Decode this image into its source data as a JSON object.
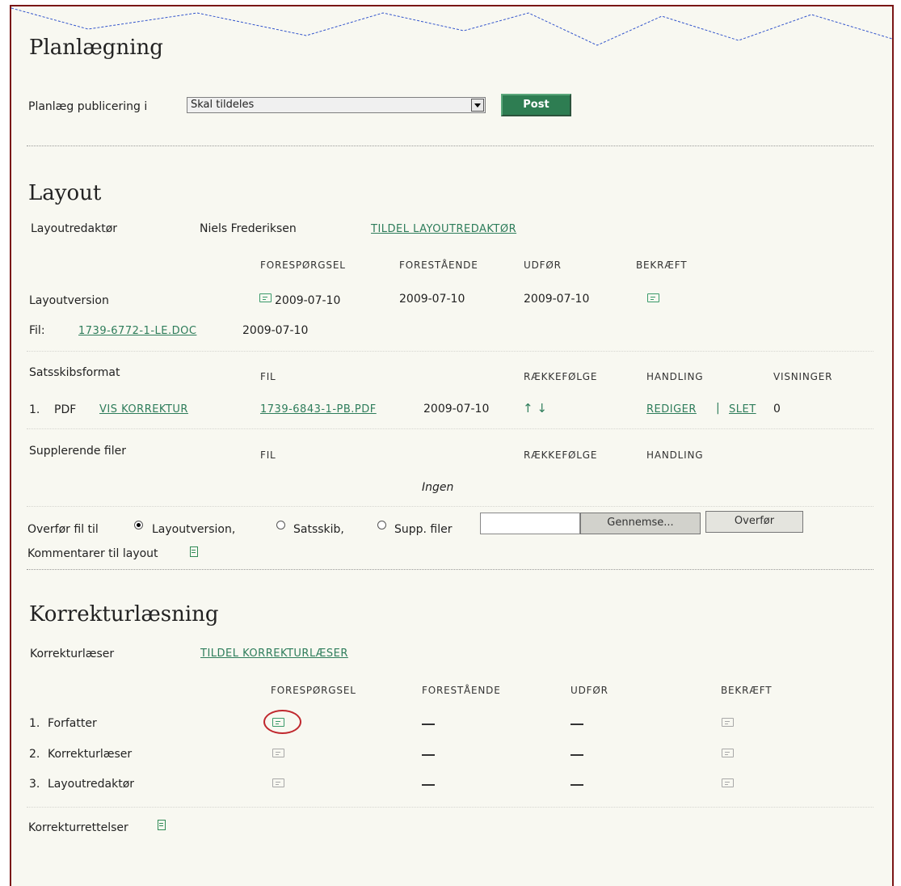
{
  "scheduling": {
    "title": "Planlægning",
    "label": "Planlæg publicering i",
    "select_value": "Skal tildeles",
    "post_button": "Post"
  },
  "layout": {
    "title": "Layout",
    "editor_label": "Layoutredaktør",
    "editor_name": "Niels Frederiksen",
    "assign_link": "TILDEL LAYOUTREDAKTØR",
    "columns": [
      "FORESPØRGSEL",
      "FORESTÅENDE",
      "UDFØR",
      "BEKRÆFT"
    ],
    "version_label": "Layoutversion",
    "request_date": "2009-07-10",
    "underway_date": "2009-07-10",
    "complete_date": "2009-07-10",
    "file_label": "Fil:",
    "file_link": "1739-6772-1-LE.DOC",
    "file_date": "2009-07-10",
    "galley": {
      "label": "Satsskibsformat",
      "columns": [
        "FIL",
        "RÆKKEFØLGE",
        "HANDLING",
        "VISNINGER"
      ],
      "row_number": "1.",
      "row_format": "PDF",
      "proof_link": "VIS KORREKTUR",
      "file_link": "1739-6843-1-PB.PDF",
      "file_date": "2009-07-10",
      "order_arrows": "↑ ↓",
      "edit_link": "REDIGER",
      "action_separator": "|",
      "delete_link": "SLET",
      "views": "0"
    },
    "supplementary": {
      "label": "Supplerende filer",
      "columns": [
        "FIL",
        "RÆKKEFØLGE",
        "HANDLING"
      ],
      "empty_text": "Ingen"
    },
    "upload": {
      "label": "Overfør fil til",
      "options": [
        "Layoutversion,",
        "Satsskib,",
        "Supp. filer"
      ],
      "selected": "Layoutversion,",
      "browse_button": "Gennemse...",
      "upload_button": "Overfør"
    },
    "comments_label": "Kommentarer til layout"
  },
  "proofreading": {
    "title": "Korrekturlæsning",
    "proofreader_label": "Korrekturlæser",
    "assign_link": "TILDEL KORREKTURLÆSER",
    "columns": [
      "FORESPØRGSEL",
      "FORESTÅENDE",
      "UDFØR",
      "BEKRÆFT"
    ],
    "rows": [
      {
        "num": "1.",
        "label": "Forfatter"
      },
      {
        "num": "2.",
        "label": "Korrekturlæser"
      },
      {
        "num": "3.",
        "label": "Layoutredaktør"
      }
    ],
    "corrections_label": "Korrekturrettelser"
  },
  "colors": {
    "frame_border": "#7a1616",
    "link": "#2e7d5b",
    "post_button": "#2e7d52",
    "highlight": "#c0282e"
  }
}
